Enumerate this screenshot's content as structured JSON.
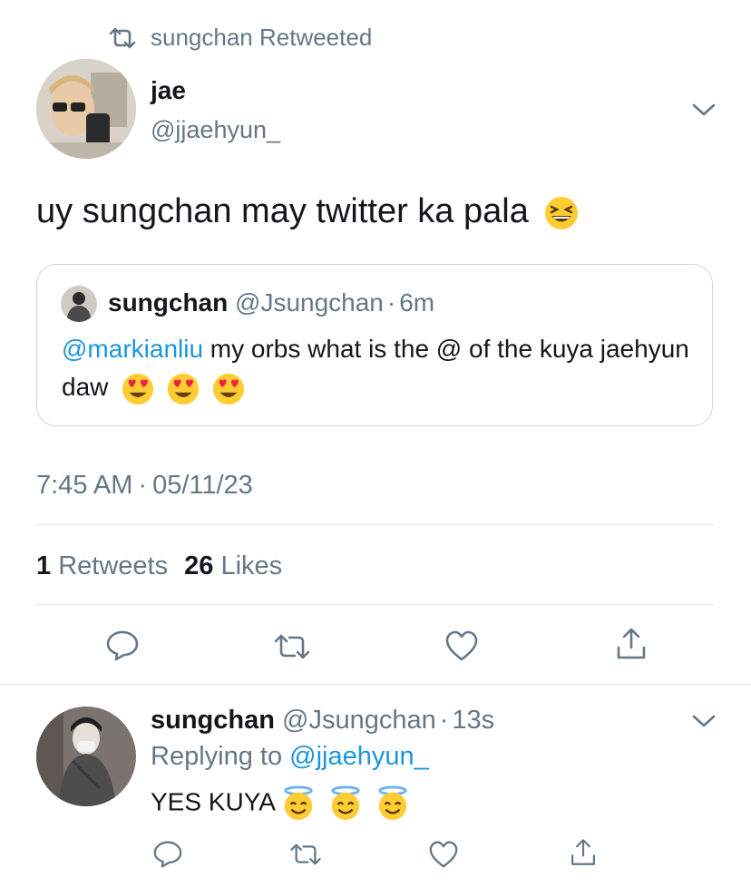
{
  "context": {
    "retweet_label": "sungchan Retweeted"
  },
  "tweet": {
    "name": "jae",
    "handle": "@jjaehyun_",
    "text": "uy sungchan may twitter ka pala",
    "text_emoji": "grinning-squinting-face",
    "quote": {
      "name": "sungchan",
      "handle": "@Jsungchan",
      "sep": "·",
      "time": "6m",
      "mention": "@markianliu",
      "text": " my orbs what is the @ of the kuya jaehyun daw",
      "emojis": [
        "heart-eyes",
        "heart-eyes",
        "heart-eyes"
      ]
    },
    "time": "7:45 AM",
    "sep": "·",
    "date": "05/11/23",
    "stats": {
      "retweets_count": "1",
      "retweets_label": "Retweets",
      "likes_count": "26",
      "likes_label": "Likes"
    }
  },
  "reply": {
    "name": "sungchan",
    "handle": "@Jsungchan",
    "sep": "·",
    "time": "13s",
    "replying_label": "Replying to",
    "replying_handle": "@jjaehyun_",
    "text": "YES KUYA",
    "emojis": [
      "smiling-face-with-halo",
      "smiling-face-with-halo",
      "smiling-face-with-halo"
    ]
  },
  "colors": {
    "text": "#14171a",
    "secondary": "#657786",
    "link": "#1b95e0",
    "divider": "#e1e8ed"
  }
}
